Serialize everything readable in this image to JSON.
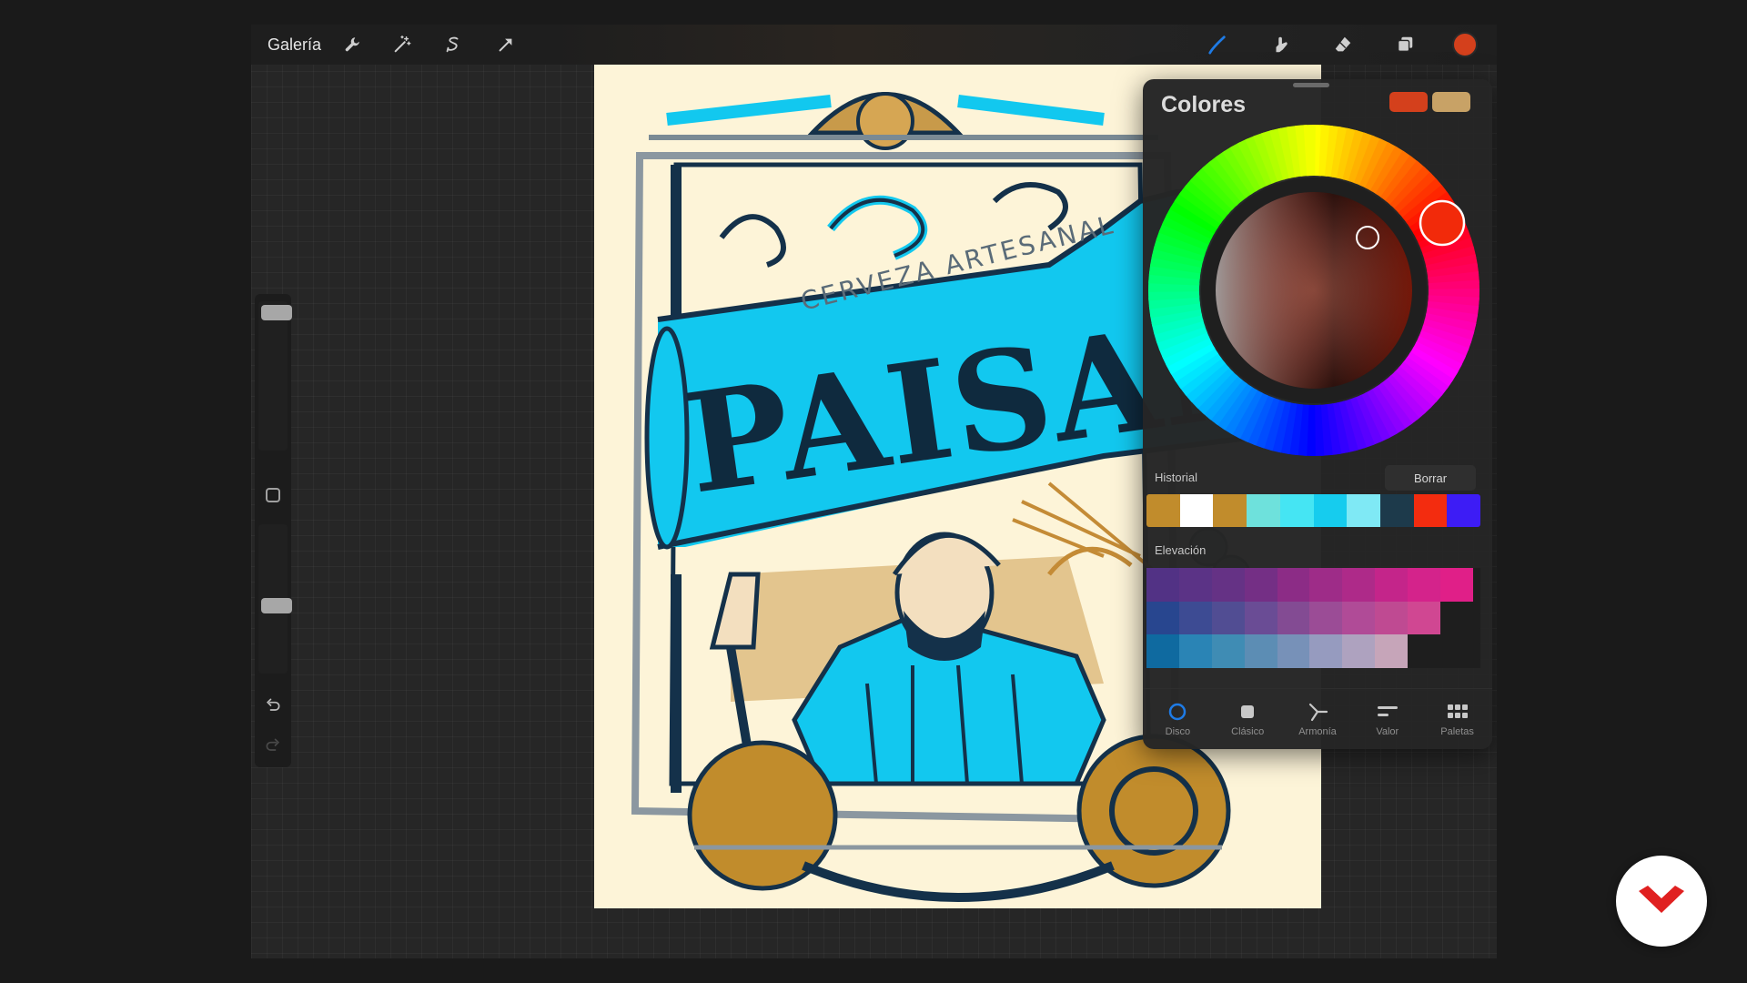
{
  "topbar": {
    "gallery_label": "Galería",
    "left_tools": [
      "wrench-icon",
      "magic-wand-icon",
      "selection-icon",
      "transform-arrow-icon"
    ],
    "right_tools": [
      "brush-icon",
      "smudge-icon",
      "eraser-icon",
      "layers-icon"
    ],
    "current_color": "#d4401c"
  },
  "sidebar": {
    "brush_size_level": 0.03,
    "opacity_level": 0.55,
    "icons": [
      "modify-square-icon",
      "undo-icon",
      "redo-icon"
    ]
  },
  "canvas": {
    "background_color": "#fdf4d8",
    "banner_top_text": "CERVEZA ARTESANAL",
    "banner_main_text": "PAISANO"
  },
  "color_panel": {
    "title": "Colores",
    "current_swatches": [
      "#d4401c",
      "#c8a266"
    ],
    "history_label": "Historial",
    "clear_label": "Borrar",
    "history_colors": [
      "#c18c2c",
      "#ffffff",
      "#c18c2c",
      "#6ee1dc",
      "#45e5f3",
      "#16ccee",
      "#7fe9f5",
      "#1d3a4b",
      "#f32c0f",
      "#3d1cf5"
    ],
    "palette_label": "Elevación",
    "palette_rows": [
      [
        "#523285",
        "#5b3386",
        "#653285",
        "#742f85",
        "#8c2c86",
        "#9e2c88",
        "#ae2a89",
        "#c4258a",
        "#d4238b",
        "#e01f88"
      ],
      [
        "#28468f",
        "#3d4b93",
        "#514d93",
        "#6a4c95",
        "#834b93",
        "#9b4c96",
        "#b04b97",
        "#bf4a92",
        "#d04792"
      ],
      [
        "#0f6aa0",
        "#2a84b5",
        "#3f8cb4",
        "#5c8db4",
        "#7791b8",
        "#969bbf",
        "#aea2bf",
        "#c6a5b9"
      ]
    ],
    "tabs": [
      {
        "label": "Disco",
        "icon": "disc-icon",
        "active": true
      },
      {
        "label": "Clásico",
        "icon": "classic-square-icon",
        "active": false
      },
      {
        "label": "Armonía",
        "icon": "harmony-icon",
        "active": false
      },
      {
        "label": "Valor",
        "icon": "value-sliders-icon",
        "active": false
      },
      {
        "label": "Paletas",
        "icon": "palettes-grid-icon",
        "active": false
      }
    ]
  },
  "colors": {
    "accent_blue": "#1e7be6",
    "logo_red": "#e02020"
  }
}
